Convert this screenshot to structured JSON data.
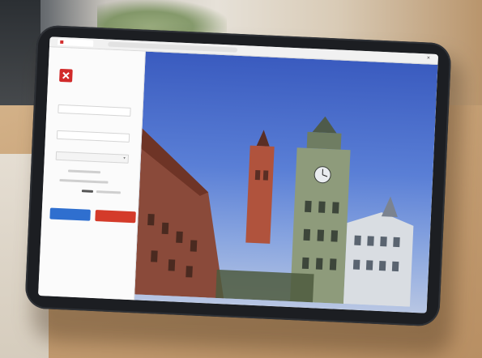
{
  "browser": {
    "tab_title": "",
    "address": "",
    "close_glyph": "×"
  },
  "login": {
    "logo_text": "",
    "username_label": "",
    "password_label": "",
    "select_value": "",
    "remember_text": "",
    "primary_button_label": "",
    "secondary_button_label": "",
    "link_text": ""
  },
  "colors": {
    "brand_red": "#d12a2a",
    "primary_blue": "#2f6fcf",
    "danger_red": "#d43b2a",
    "sky_blue": "#3a5bbf"
  },
  "icons": {
    "logo": "logo-mark-icon",
    "dropdown": "chevron-down-icon"
  }
}
